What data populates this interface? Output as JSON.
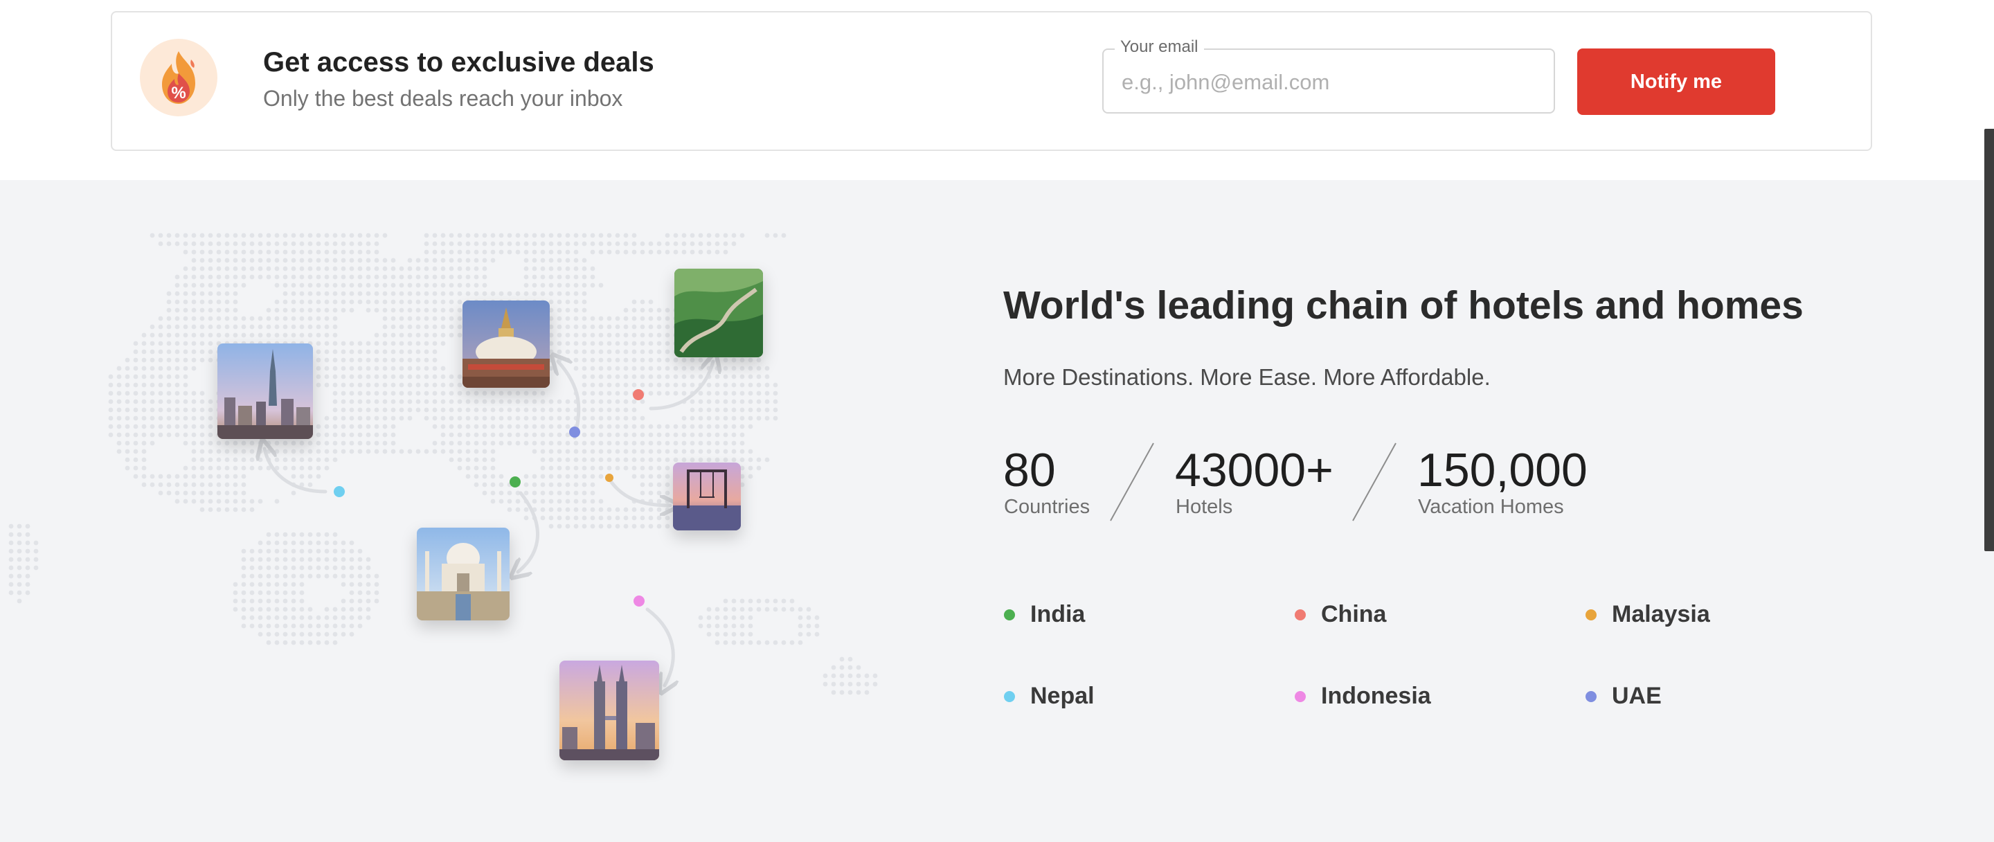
{
  "deals": {
    "title": "Get access to exclusive deals",
    "subtitle": "Only the best deals reach your inbox",
    "icon": "fire-percent-icon",
    "email": {
      "label": "Your email",
      "placeholder": "e.g., john@email.com",
      "value": ""
    },
    "notify_label": "Notify me",
    "accent": "#e03a2f"
  },
  "world": {
    "headline": "World's leading chain of hotels and homes",
    "tagline": "More Destinations. More Ease. More Affordable.",
    "stats": [
      {
        "value": "80",
        "label": "Countries"
      },
      {
        "value": "43000+",
        "label": "Hotels"
      },
      {
        "value": "150,000",
        "label": "Vacation Homes"
      }
    ],
    "countries": [
      {
        "name": "India",
        "color": "#4caf50"
      },
      {
        "name": "China",
        "color": "#f07b72"
      },
      {
        "name": "Malaysia",
        "color": "#e8a43b"
      },
      {
        "name": "Nepal",
        "color": "#6fcff0"
      },
      {
        "name": "Indonesia",
        "color": "#ee88e4"
      },
      {
        "name": "UAE",
        "color": "#7f8ee0"
      }
    ],
    "photos": [
      {
        "name": "dubai-skyline-photo"
      },
      {
        "name": "nepal-stupa-photo"
      },
      {
        "name": "great-wall-photo"
      },
      {
        "name": "bali-swing-photo"
      },
      {
        "name": "taj-mahal-photo"
      },
      {
        "name": "petronas-towers-photo"
      }
    ]
  }
}
